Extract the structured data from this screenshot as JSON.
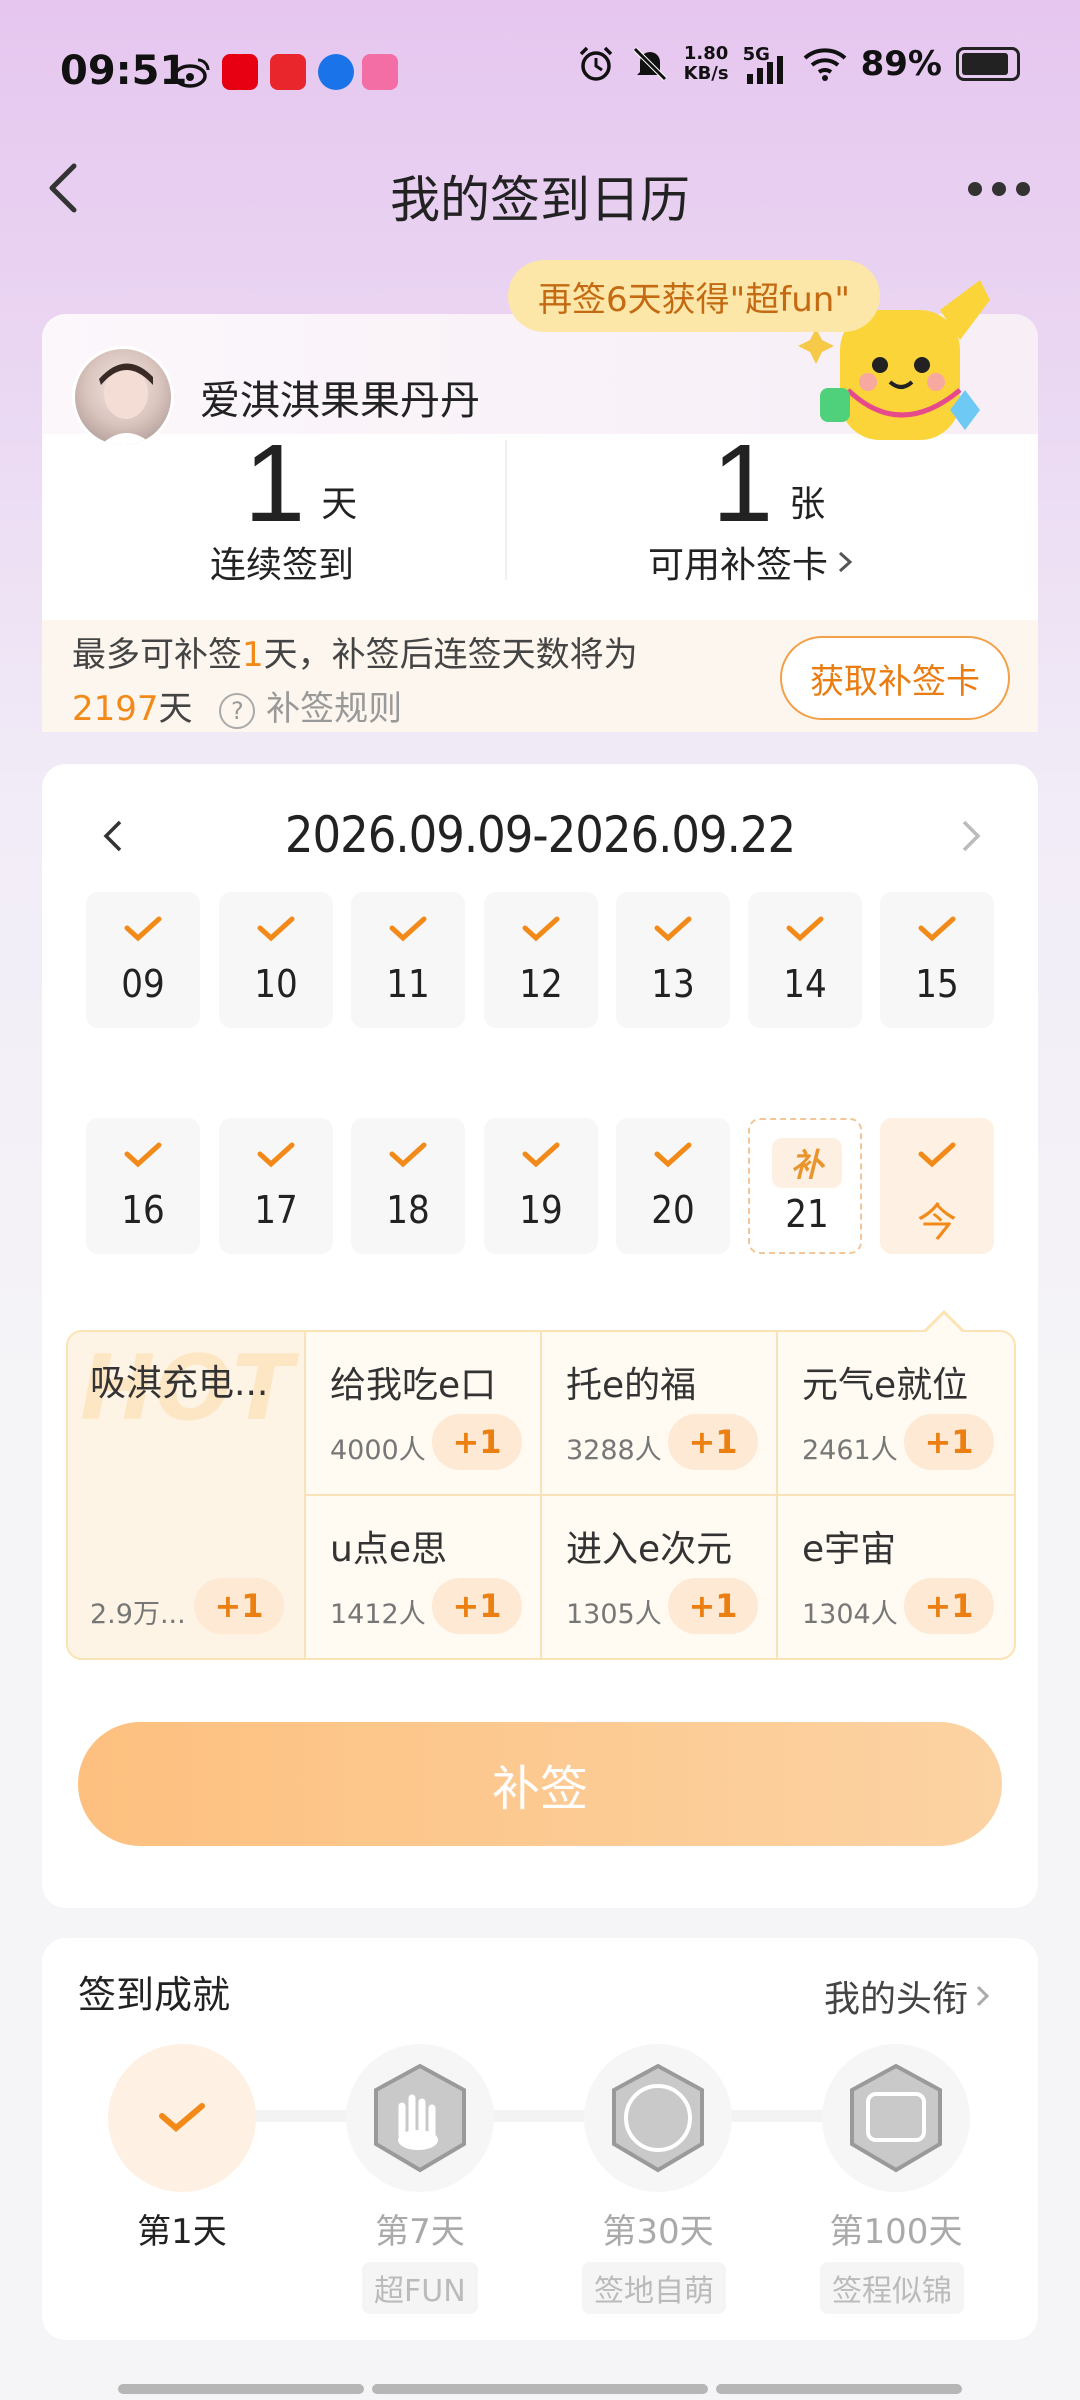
{
  "status_bar": {
    "time": "09:51",
    "net_speed_value": "1.80",
    "net_speed_unit": "KB/s",
    "network": "5G",
    "battery": "89%"
  },
  "header": {
    "title": "我的签到日历"
  },
  "profile": {
    "username": "爱淇淇果果丹丹",
    "promo": "再签6天获得\"超fun\"",
    "streak_value": "1",
    "streak_unit": "天",
    "streak_label": "连续签到",
    "cards_value": "1",
    "cards_unit": "张",
    "cards_label": "可用补签卡",
    "tip_line1_a": "最多可补签",
    "tip_line1_num": "1",
    "tip_line1_b": "天，补签后连签天数将为",
    "tip_line2_num": "2197",
    "tip_line2_unit": "天",
    "rule_link": "补签规则",
    "get_card_button": "获取补签卡"
  },
  "calendar": {
    "range": "2026.09.09-2026.09.22",
    "row1": [
      "09",
      "10",
      "11",
      "12",
      "13",
      "14",
      "15"
    ],
    "row2": [
      "16",
      "17",
      "18",
      "19",
      "20"
    ],
    "makeup_day": "21",
    "makeup_badge": "补",
    "today_label": "今"
  },
  "topics": {
    "hot_watermark": "HOT",
    "hot": {
      "name": "吸淇充电...",
      "count": "2.9万...",
      "plus": "+1"
    },
    "items": [
      {
        "name": "给我吃e口",
        "count": "4000人",
        "plus": "+1"
      },
      {
        "name": "托e的福",
        "count": "3288人",
        "plus": "+1"
      },
      {
        "name": "元气e就位",
        "count": "2461人",
        "plus": "+1"
      },
      {
        "name": "u点e思",
        "count": "1412人",
        "plus": "+1"
      },
      {
        "name": "进入e次元",
        "count": "1305人",
        "plus": "+1"
      },
      {
        "name": "e宇宙",
        "count": "1304人",
        "plus": "+1"
      }
    ]
  },
  "makeup_button": "补签",
  "achievements": {
    "title": "签到成就",
    "link": "我的头衔",
    "badges": [
      {
        "label": "第1天",
        "tag": ""
      },
      {
        "label": "第7天",
        "tag": "超FUN"
      },
      {
        "label": "第30天",
        "tag": "签地自萌"
      },
      {
        "label": "第100天",
        "tag": "签程似锦"
      }
    ]
  },
  "colors": {
    "accent_orange": "#f28a1a",
    "button_gradient_start": "#fdc07f",
    "promo_bubble": "#fde7a8"
  }
}
